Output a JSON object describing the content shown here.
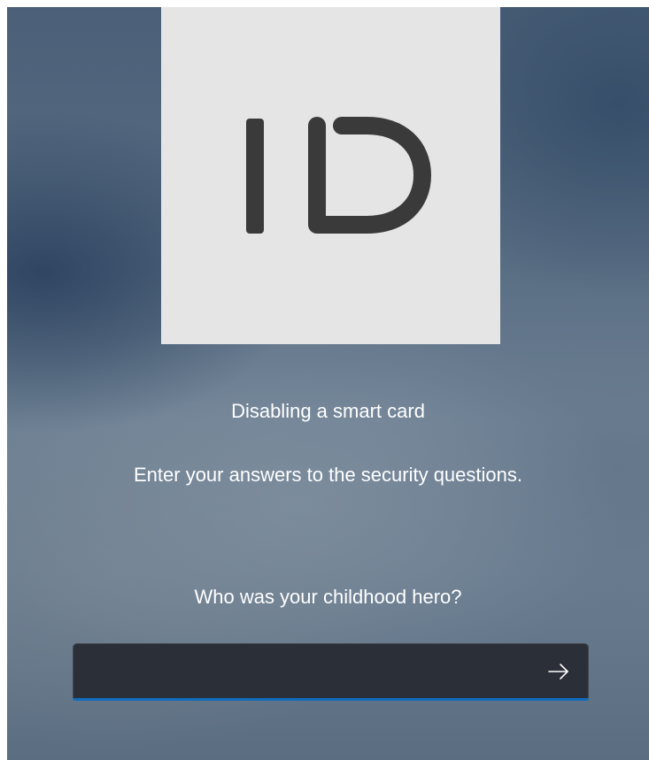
{
  "logo": {
    "icon": "id-badge-logo",
    "text": "ID",
    "tile_color": "#e5e5e5",
    "glyph_color": "#3a3a3a"
  },
  "dialog": {
    "title": "Disabling a smart card",
    "instructions": "Enter your answers to the security questions."
  },
  "security_question": {
    "question": "Who was your childhood hero?",
    "answer_value": "",
    "answer_placeholder": "",
    "submit_icon": "arrow-right-icon",
    "focus_color": "#0f6cbd"
  }
}
